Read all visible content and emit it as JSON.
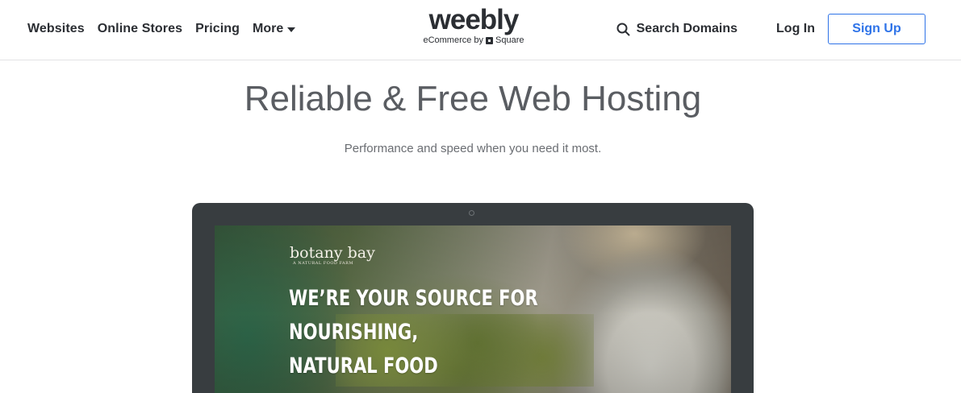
{
  "nav": {
    "items": [
      {
        "label": "Websites"
      },
      {
        "label": "Online Stores"
      },
      {
        "label": "Pricing"
      }
    ],
    "more_label": "More"
  },
  "logo": {
    "word": "weebly",
    "sub_prefix": "eCommerce by",
    "sub_brand": "Square"
  },
  "actions": {
    "search_label": "Search Domains",
    "login_label": "Log In",
    "signup_label": "Sign Up"
  },
  "hero": {
    "title": "Reliable & Free Web Hosting",
    "subtitle": "Performance and speed when you need it most."
  },
  "preview": {
    "brand": "botany bay",
    "tagline": "A NATURAL FOOD FARM",
    "headline_line1": "WE’RE YOUR SOURCE FOR NOURISHING,",
    "headline_line2": "NATURAL FOOD"
  },
  "colors": {
    "text": "#2b2e33",
    "accent": "#2e73e8",
    "laptop": "#383d40",
    "hero_title": "#5a5d62"
  },
  "icons": {
    "search": "search-icon",
    "caret": "caret-down-icon",
    "square": "square-logo-icon",
    "camera": "camera-icon"
  }
}
